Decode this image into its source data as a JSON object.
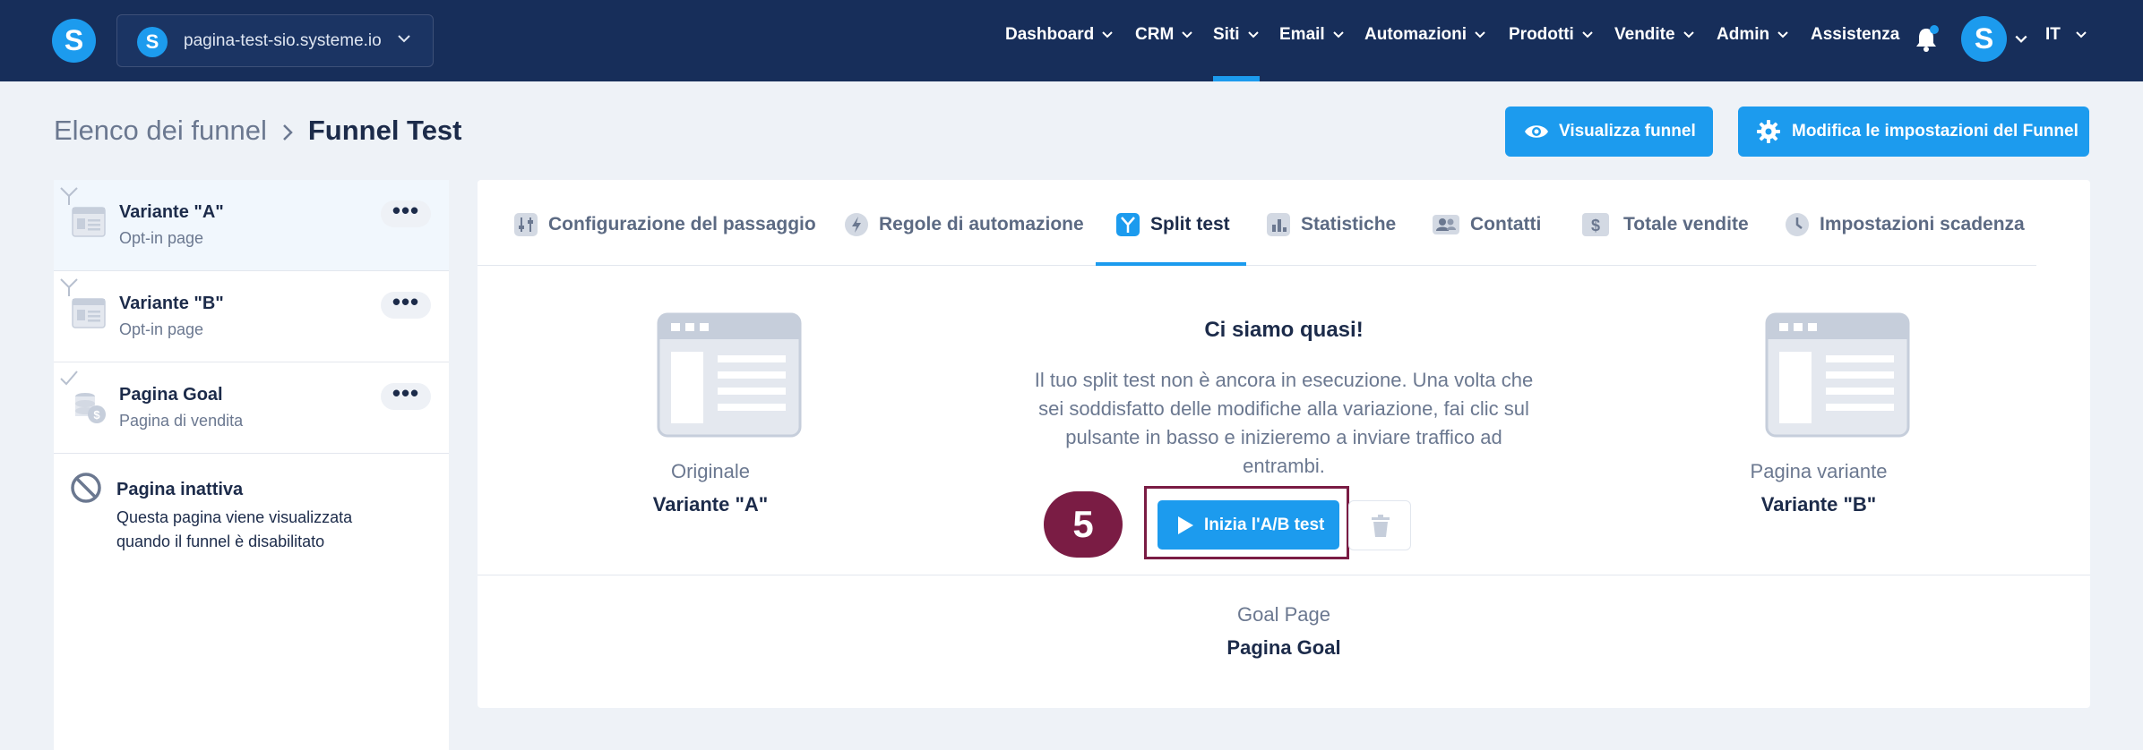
{
  "app": {
    "logo_letter": "S",
    "site_selector": {
      "value": "pagina-test-sio.systeme.io"
    },
    "avatar_letter": "S"
  },
  "nav": {
    "items": [
      {
        "label": "Dashboard"
      },
      {
        "label": "CRM"
      },
      {
        "label": "Siti",
        "active": true
      },
      {
        "label": "Email"
      },
      {
        "label": "Automazioni"
      },
      {
        "label": "Prodotti"
      },
      {
        "label": "Vendite"
      },
      {
        "label": "Admin"
      },
      {
        "label": "Assistenza"
      }
    ],
    "language": "IT"
  },
  "header": {
    "breadcrumb_parent": "Elenco dei funnel",
    "breadcrumb_current": "Funnel Test",
    "view_button": "Visualizza funnel",
    "settings_button": "Modifica le impostazioni del Funnel"
  },
  "sidebar": {
    "steps": [
      {
        "title": "Variante \"A\"",
        "subtitle": "Opt-in page",
        "more": "•••",
        "icon": "page-icon"
      },
      {
        "title": "Variante \"B\"",
        "subtitle": "Opt-in page",
        "more": "•••",
        "icon": "page-icon"
      },
      {
        "title": "Pagina Goal",
        "subtitle": "Pagina di vendita",
        "more": "•••",
        "icon": "coins-icon"
      }
    ],
    "inactive": {
      "title": "Pagina inattiva",
      "description": "Questa pagina viene visualizzata quando il funnel è disabilitato"
    }
  },
  "tabs": [
    {
      "label": "Configurazione del passaggio",
      "icon": "sliders-icon"
    },
    {
      "label": "Regole di automazione",
      "icon": "bolt-icon"
    },
    {
      "label": "Split test",
      "icon": "split-icon",
      "active": true
    },
    {
      "label": "Statistiche",
      "icon": "bar-chart-icon"
    },
    {
      "label": "Contatti",
      "icon": "users-icon"
    },
    {
      "label": "Totale vendite",
      "icon": "dollar-icon"
    },
    {
      "label": "Impostazioni scadenza",
      "icon": "clock-icon"
    }
  ],
  "split_test": {
    "original_caption": "Originale",
    "original_name": "Variante \"A\"",
    "variant_caption": "Pagina variante",
    "variant_name": "Variante \"B\"",
    "title": "Ci siamo quasi!",
    "description": "Il tuo split test non è ancora in esecuzione. Una volta che sei soddisfatto delle modifiche alla variazione, fai clic sul pulsante in basso e inizieremo a inviare traffico ad entrambi.",
    "start_button": "Inizia l'A/B test",
    "step_badge": "5",
    "goal_caption": "Goal Page",
    "goal_name": "Pagina Goal"
  },
  "colors": {
    "topbar": "#172e5a",
    "accent": "#1c9bee",
    "highlight": "#7a1c44",
    "background": "#eef2f7"
  }
}
